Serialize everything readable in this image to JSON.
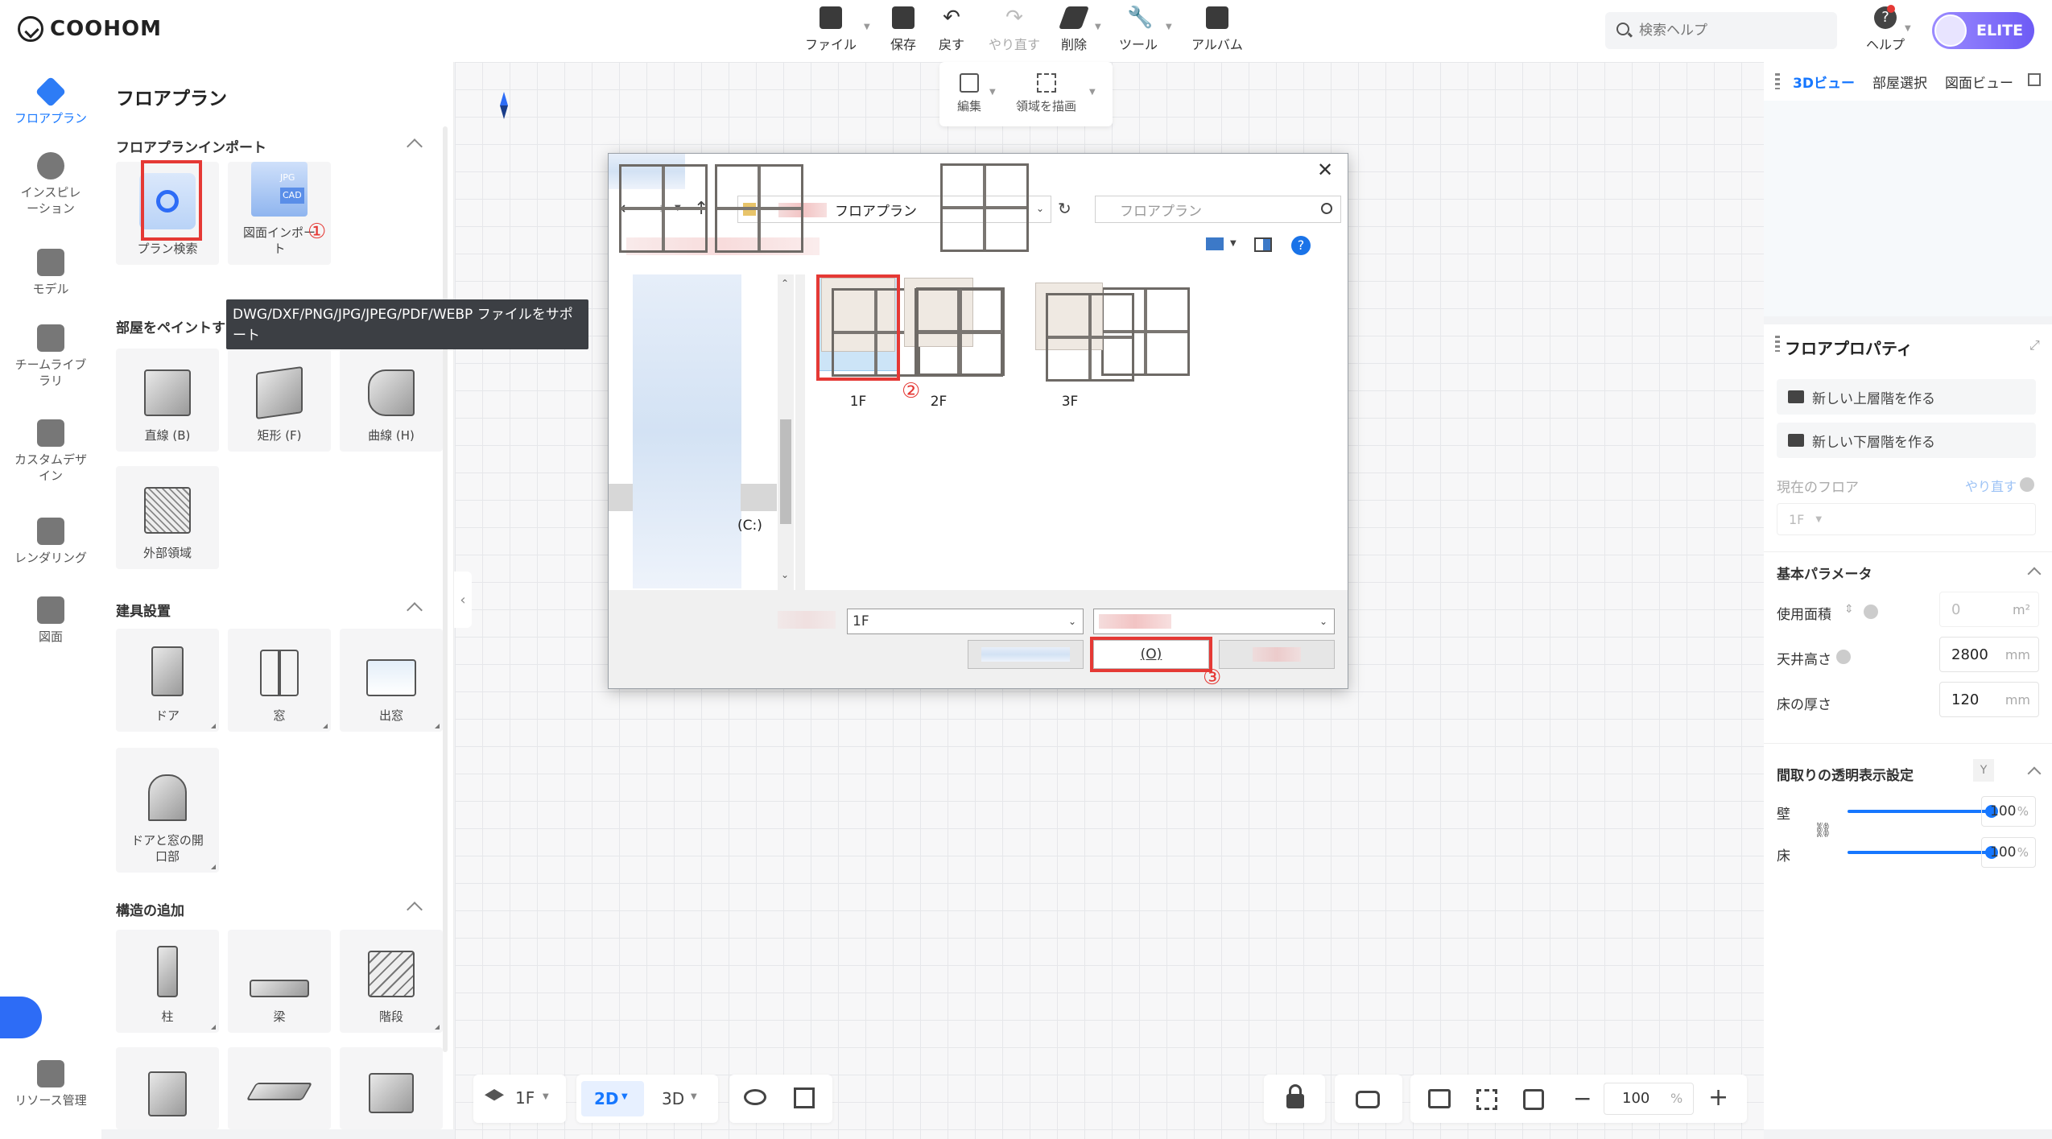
{
  "app": {
    "brand": "COOHOM"
  },
  "toolbar": {
    "file": "ファイル",
    "save": "保存",
    "undo": "戻す",
    "redo": "やり直す",
    "delete": "削除",
    "tools": "ツール",
    "album": "アルバム",
    "help": "ヘルプ",
    "badge": "ELITE",
    "search_placeholder": "検索ヘルプ"
  },
  "edit_bar": {
    "edit": "編集",
    "draw_area": "領域を描画"
  },
  "rail": [
    {
      "label": "フロアプラン",
      "icon": "floorplan-icon"
    },
    {
      "label": "インスピレーション",
      "icon": "lightbulb-icon"
    },
    {
      "label": "モデル",
      "icon": "sofa-icon"
    },
    {
      "label": "チームライブラリ",
      "icon": "crown-icon"
    },
    {
      "label": "カスタムデザイン",
      "icon": "custom-design-icon"
    },
    {
      "label": "レンダリング",
      "icon": "camera-icon"
    },
    {
      "label": "図面",
      "icon": "drawing-icon"
    },
    {
      "label": "リソース管理",
      "icon": "resource-icon"
    }
  ],
  "panel": {
    "title": "フロアプラン",
    "import_section": "フロアプランインポート",
    "plan_search": "プラン検索",
    "drawing_import": "図面インポート",
    "import_icon_text": [
      "JPG",
      "CAD"
    ],
    "tooltip": "DWG/DXF/PNG/JPG/JPEG/PDF/WEBP ファイルをサポート",
    "paint_section": "部屋をペイントす",
    "paint_items": [
      "直線 (B)",
      "矩形 (F)",
      "曲線 (H)",
      "外部領域"
    ],
    "fixtures_section": "建具設置",
    "fixtures": [
      "ドア",
      "窓",
      "出窓",
      "ドアと窓の開口部"
    ],
    "structure_section": "構造の追加",
    "structures": [
      "柱",
      "梁",
      "階段"
    ],
    "markers": [
      "①",
      "②",
      "③"
    ]
  },
  "right_top": {
    "tabs": [
      "3Dビュー",
      "部屋選択",
      "図面ビュー"
    ]
  },
  "props": {
    "title": "フロアプロパティ",
    "new_upper": "新しい上層階を作る",
    "new_lower": "新しい下層階を作る",
    "current_floor": "現在のフロア",
    "redo": "やり直す",
    "floor_value": "1F",
    "basic_params": "基本パラメータ",
    "area_label": "使用面積",
    "area_value": "0",
    "area_unit": "m²",
    "ceiling_label": "天井高さ",
    "ceiling_value": "2800",
    "thickness_label": "床の厚さ",
    "thickness_value": "120",
    "unit_mm": "mm",
    "transparency_title": "間取りの透明表示設定",
    "transparency_key": "Y",
    "wall_label": "壁",
    "floor_label": "床",
    "wall_value": "100",
    "floor_value_pct": "100",
    "pct": "%"
  },
  "bottom": {
    "floor": "1F",
    "mode2d": "2D",
    "mode3d": "3D",
    "zoom": "100",
    "zoom_unit": "%"
  },
  "dialog": {
    "folder": "フロアプラン",
    "search_placeholder": "フロアプラン",
    "drive": "(C:)",
    "files": [
      "1F",
      "2F",
      "3F"
    ],
    "filename": "1F",
    "open_button": "(O)"
  },
  "colors": {
    "accent": "#1677ff",
    "highlight": "#e53935",
    "elite": "#7b61ff"
  }
}
